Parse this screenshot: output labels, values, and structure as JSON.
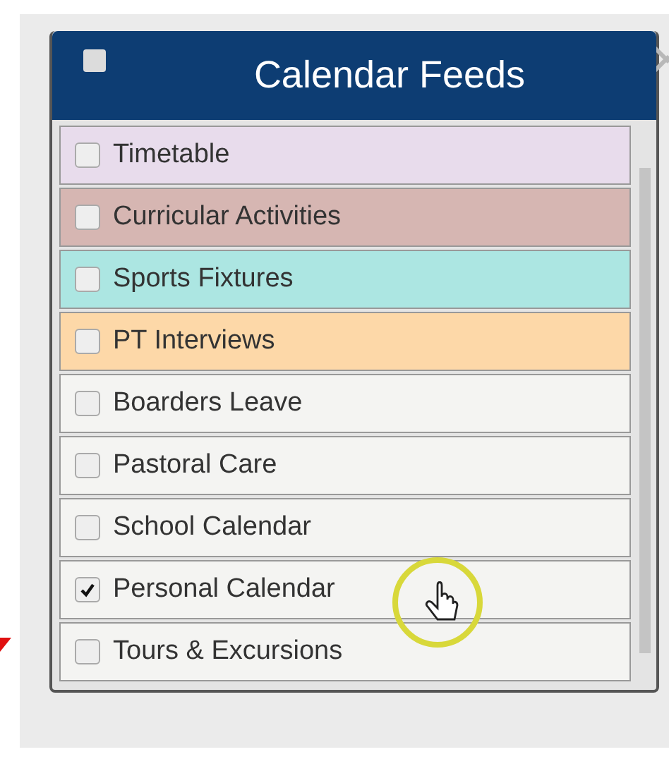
{
  "panel": {
    "title": "Calendar Feeds",
    "select_all": {
      "checked": false
    }
  },
  "feeds": [
    {
      "label": "Timetable",
      "checked": false,
      "color": "#e8dcec"
    },
    {
      "label": "Curricular Activities",
      "checked": false,
      "color": "#d6b6b2"
    },
    {
      "label": "Sports Fixtures",
      "checked": false,
      "color": "#ace6e2"
    },
    {
      "label": "PT Interviews",
      "checked": false,
      "color": "#fdd8a8"
    },
    {
      "label": "Boarders Leave",
      "checked": false,
      "color": "#f4f4f2"
    },
    {
      "label": "Pastoral Care",
      "checked": false,
      "color": "#f4f4f2"
    },
    {
      "label": "School Calendar",
      "checked": false,
      "color": "#f4f4f2"
    },
    {
      "label": "Personal Calendar",
      "checked": true,
      "color": "#f4f4f2"
    },
    {
      "label": "Tours & Excursions",
      "checked": false,
      "color": "#f4f4f2"
    }
  ]
}
